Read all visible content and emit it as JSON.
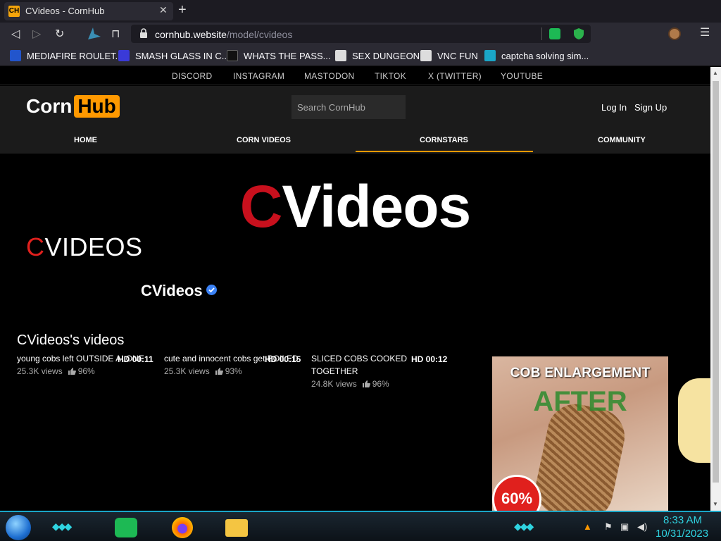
{
  "browser": {
    "tab": {
      "favicon_text": "CH",
      "title": "CVideos - CornHub",
      "close": "✕"
    },
    "new_tab": "+",
    "nav": {
      "back": "◁",
      "forward": "▷",
      "reload": "↻",
      "bookmark": "⊓",
      "menu": "☰"
    },
    "url": {
      "host": "cornhub.website",
      "path": "/model/cvideos"
    },
    "bookmarks": [
      {
        "label": "MEDIAFIRE ROULET...",
        "color": "#2255cc"
      },
      {
        "label": "SMASH GLASS IN C...",
        "color": "#3a3ad8"
      },
      {
        "label": "WHATS THE PASS...",
        "color": "#111111"
      },
      {
        "label": "SEX DUNGEON",
        "color": "#dddddd"
      },
      {
        "label": "VNC FUN",
        "color": "#dddddd"
      },
      {
        "label": "captcha solving sim...",
        "color": "#1aa6c8"
      }
    ]
  },
  "site": {
    "social_links": [
      "DISCORD",
      "INSTAGRAM",
      "MASTODON",
      "TIKTOK",
      "X (TWITTER)",
      "YOUTUBE"
    ],
    "logo": {
      "corn": "Corn",
      "hub": "Hub"
    },
    "search_placeholder": "Search CornHub",
    "auth": {
      "login": "Log In",
      "signup": "Sign Up"
    },
    "main_nav": [
      "HOME",
      "CORN VIDEOS",
      "CORNSTARS",
      "COMMUNITY"
    ],
    "active_nav": "CORNSTARS",
    "accent": "#ff9900"
  },
  "profile": {
    "banner": {
      "first": "C",
      "rest": "Videos"
    },
    "side_title": {
      "first": "C",
      "rest": "VIDEOS"
    },
    "name": "CVideos",
    "verified": true,
    "videos_heading": "CVideos's videos"
  },
  "videos": [
    {
      "title": "young cobs left OUTSIDE ALONE",
      "badge": "HD 00:11",
      "views": "25.3K views",
      "rating": "96%"
    },
    {
      "title": "cute and innocent cobs get BOILED",
      "badge": "HD 00:15",
      "views": "25.3K views",
      "rating": "93%"
    },
    {
      "title": "SLICED COBS COOKED TOGETHER",
      "badge": "HD 00:12",
      "views": "24.8K views",
      "rating": "96%"
    }
  ],
  "ad": {
    "headline": "COB ENLARGEMENT",
    "after": "AFTER",
    "badge": "60%"
  },
  "taskbar": {
    "time": "8:33 AM",
    "date": "10/31/2023"
  }
}
